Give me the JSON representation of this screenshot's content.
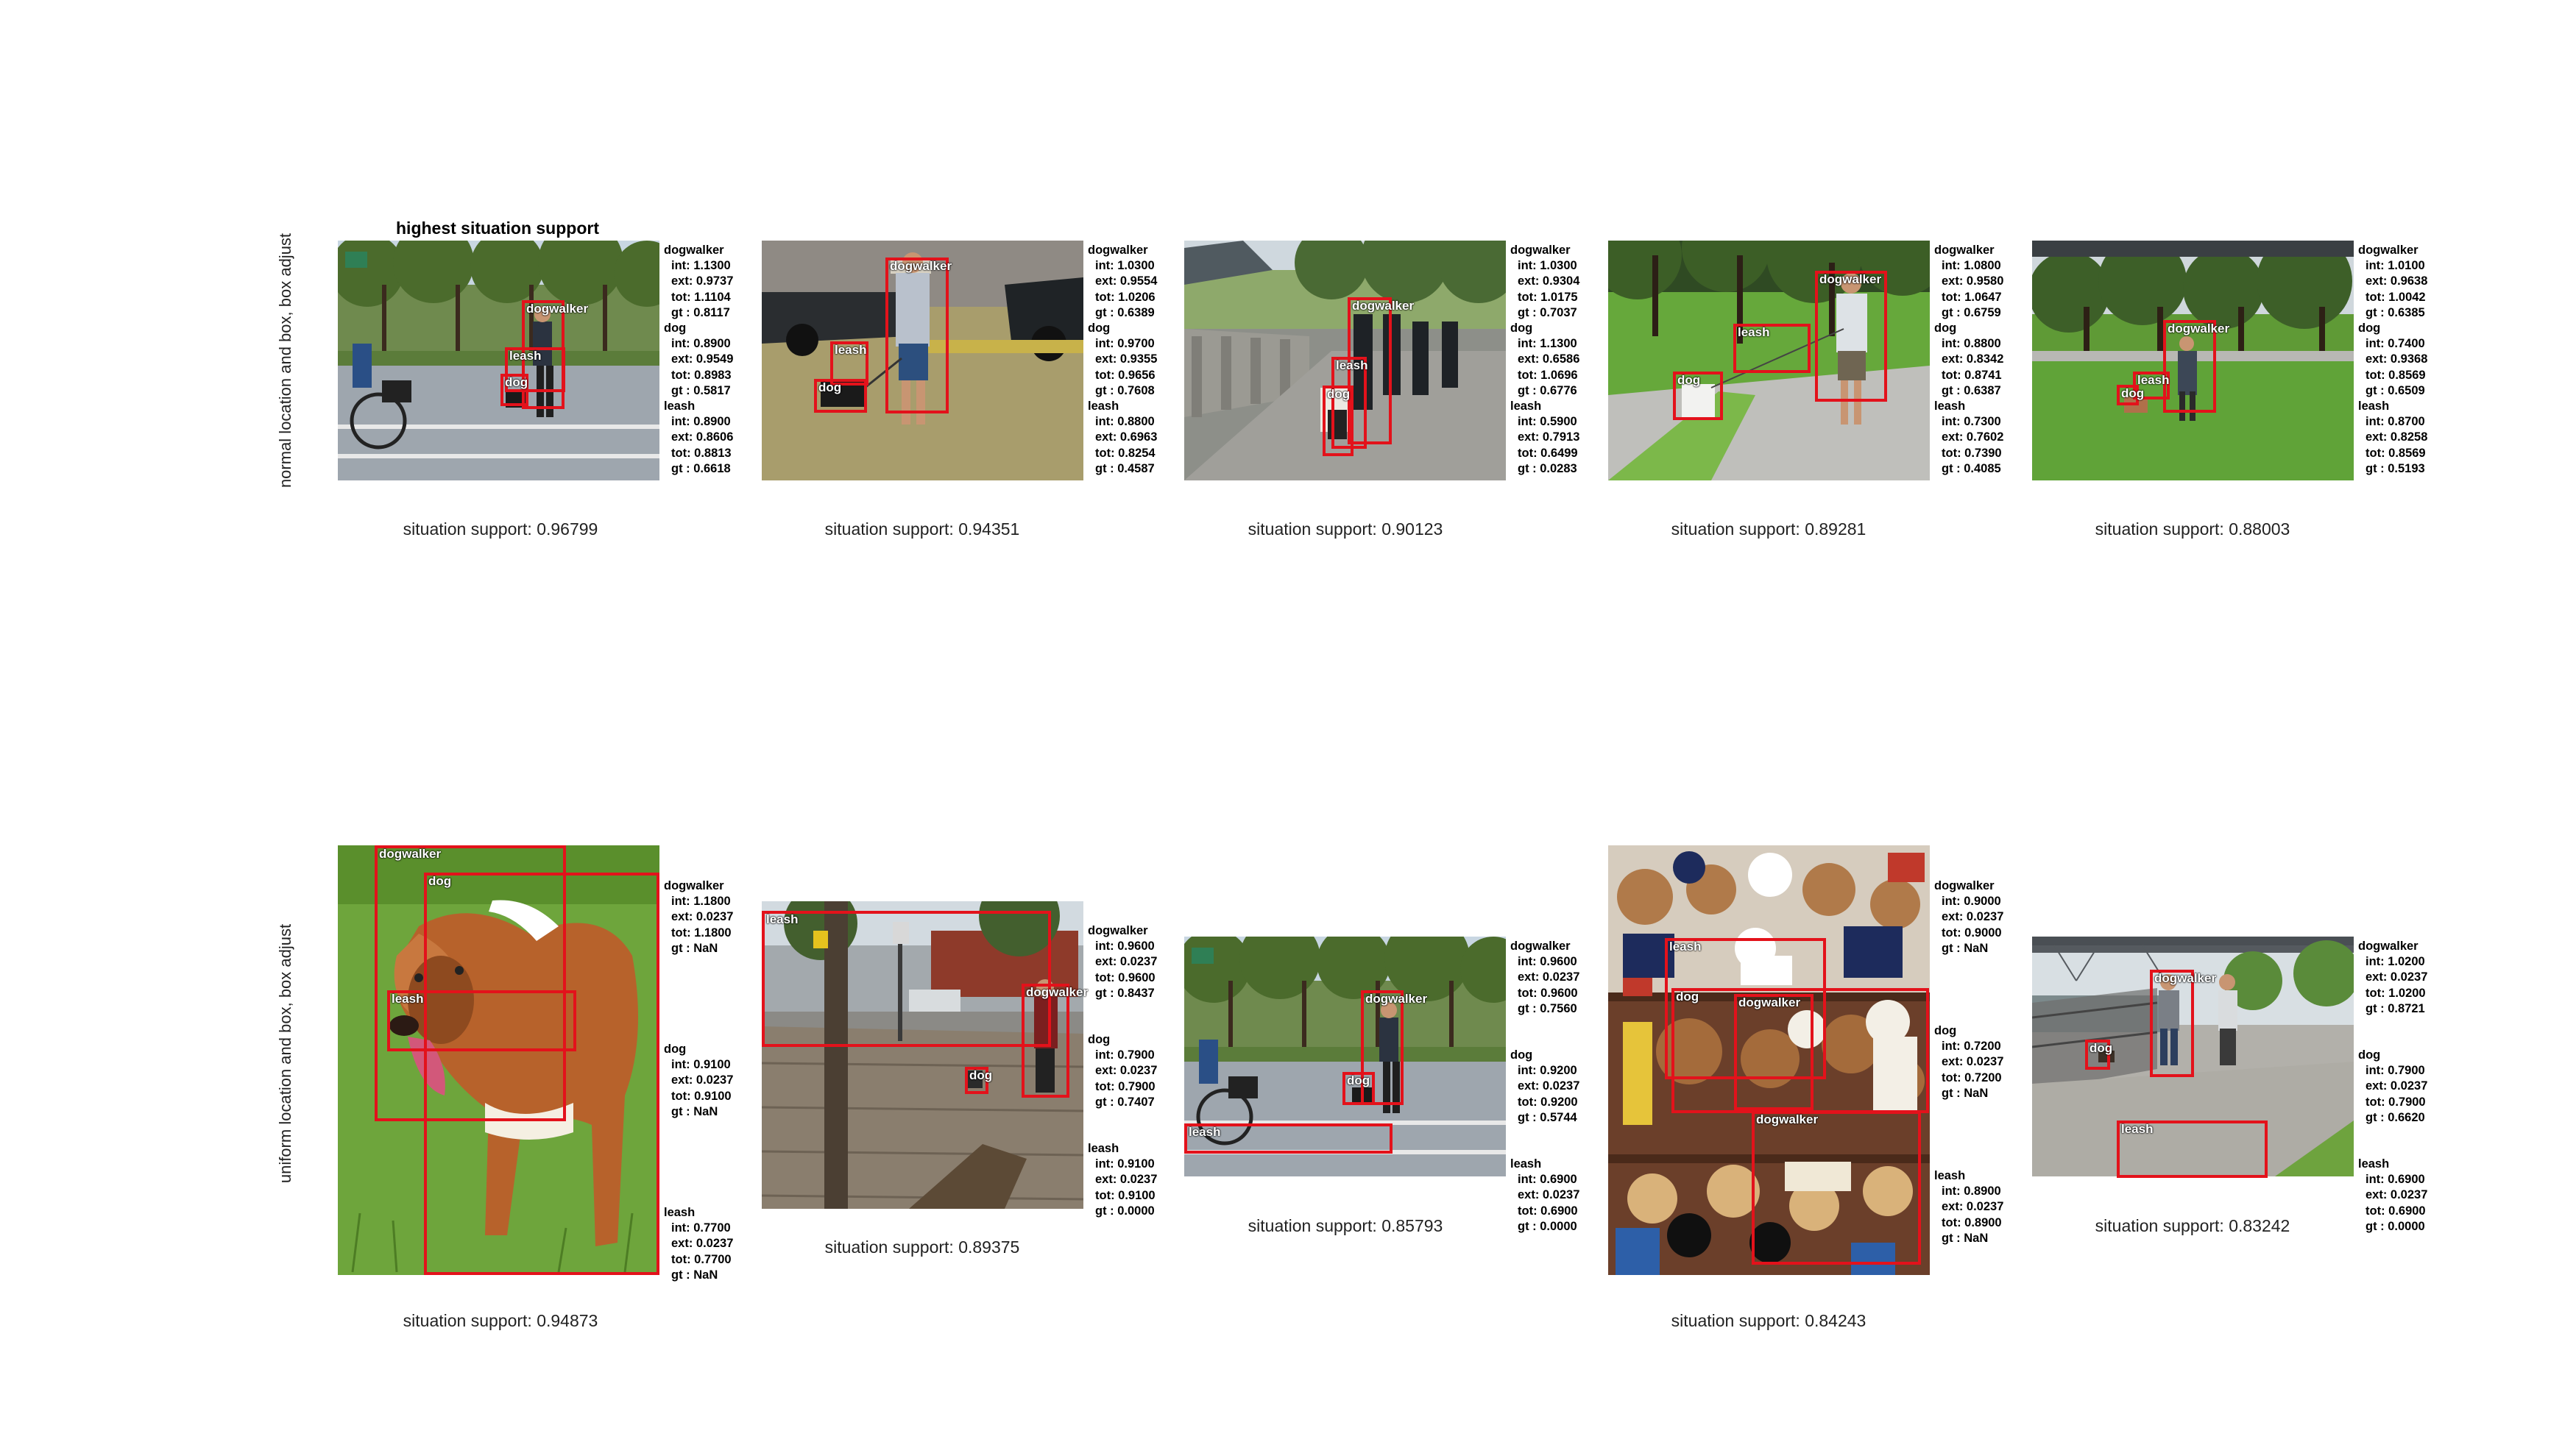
{
  "title": "highest situation support",
  "rows": [
    {
      "label": "normal location and box, box adjust",
      "cells": [
        {
          "scene": "street",
          "support": "situation support: 0.96799",
          "boxes": [
            {
              "label": "dogwalker"
            },
            {
              "label": "leash"
            },
            {
              "label": "dog"
            }
          ],
          "scores": [
            {
              "role": "dogwalker",
              "int": "int: 1.1300",
              "ext": "ext: 0.9737",
              "tot": "tot: 1.1104",
              "gt": "gt : 0.8117"
            },
            {
              "role": "dog",
              "int": "int: 0.8900",
              "ext": "ext: 0.9549",
              "tot": "tot: 0.8983",
              "gt": "gt : 0.5817"
            },
            {
              "role": "leash",
              "int": "int: 0.8900",
              "ext": "ext: 0.8606",
              "tot": "tot: 0.8813",
              "gt": "gt : 0.6618"
            }
          ]
        },
        {
          "scene": "lawn-cars",
          "support": "situation support: 0.94351",
          "boxes": [
            {
              "label": "dogwalker"
            },
            {
              "label": "leash"
            },
            {
              "label": "dog"
            }
          ],
          "scores": [
            {
              "role": "dogwalker",
              "int": "int: 1.0300",
              "ext": "ext: 0.9554",
              "tot": "tot: 1.0206",
              "gt": "gt : 0.6389"
            },
            {
              "role": "dog",
              "int": "int: 0.9700",
              "ext": "ext: 0.9355",
              "tot": "tot: 0.9656",
              "gt": "gt : 0.7608"
            },
            {
              "role": "leash",
              "int": "int: 0.8800",
              "ext": "ext: 0.6963",
              "tot": "tot: 0.8254",
              "gt": "gt : 0.4587"
            }
          ]
        },
        {
          "scene": "promenade",
          "support": "situation support: 0.90123",
          "boxes": [
            {
              "label": "dogwalker"
            },
            {
              "label": "leash"
            },
            {
              "label": "dog"
            }
          ],
          "scores": [
            {
              "role": "dogwalker",
              "int": "int: 1.0300",
              "ext": "ext: 0.9304",
              "tot": "tot: 1.0175",
              "gt": "gt : 0.7037"
            },
            {
              "role": "dog",
              "int": "int: 1.1300",
              "ext": "ext: 0.6586",
              "tot": "tot: 1.0696",
              "gt": "gt : 0.6776"
            },
            {
              "role": "leash",
              "int": "int: 0.5900",
              "ext": "ext: 0.7913",
              "tot": "tot: 0.6499",
              "gt": "gt : 0.0283"
            }
          ]
        },
        {
          "scene": "park-path",
          "support": "situation support: 0.89281",
          "boxes": [
            {
              "label": "dogwalker"
            },
            {
              "label": "leash"
            },
            {
              "label": "dog"
            }
          ],
          "scores": [
            {
              "role": "dogwalker",
              "int": "int: 1.0800",
              "ext": "ext: 0.9580",
              "tot": "tot: 1.0647",
              "gt": "gt : 0.6759"
            },
            {
              "role": "dog",
              "int": "int: 0.8800",
              "ext": "ext: 0.8342",
              "tot": "tot: 0.8741",
              "gt": "gt : 0.6387"
            },
            {
              "role": "leash",
              "int": "int: 0.7300",
              "ext": "ext: 0.7602",
              "tot": "tot: 0.7390",
              "gt": "gt : 0.4085"
            }
          ]
        },
        {
          "scene": "park-trees",
          "support": "situation support: 0.88003",
          "boxes": [
            {
              "label": "dogwalker"
            },
            {
              "label": "leash"
            },
            {
              "label": "dog"
            }
          ],
          "scores": [
            {
              "role": "dogwalker",
              "int": "int: 1.0100",
              "ext": "ext: 0.9638",
              "tot": "tot: 1.0042",
              "gt": "gt : 0.6385"
            },
            {
              "role": "dog",
              "int": "int: 0.7400",
              "ext": "ext: 0.9368",
              "tot": "tot: 0.8569",
              "gt": "gt : 0.6509"
            },
            {
              "role": "leash",
              "int": "int: 0.8700",
              "ext": "ext: 0.8258",
              "tot": "tot: 0.8569",
              "gt": "gt : 0.5193"
            }
          ]
        }
      ]
    },
    {
      "label": "uniform location and box, box adjust",
      "cells": [
        {
          "scene": "dog-closeup",
          "support": "situation support: 0.94873",
          "boxes": [
            {
              "label": "dogwalker"
            },
            {
              "label": "dog"
            },
            {
              "label": "leash"
            }
          ],
          "scores": [
            {
              "role": "dogwalker",
              "int": "int: 1.1800",
              "ext": "ext: 0.0237",
              "tot": "tot: 1.1800",
              "gt": "gt : NaN"
            },
            {
              "role": "dog",
              "int": "int: 0.9100",
              "ext": "ext: 0.0237",
              "tot": "tot: 0.9100",
              "gt": "gt : NaN"
            },
            {
              "role": "leash",
              "int": "int: 0.7700",
              "ext": "ext: 0.0237",
              "tot": "tot: 0.7700",
              "gt": "gt : NaN"
            }
          ]
        },
        {
          "scene": "boardwalk",
          "support": "situation support: 0.89375",
          "boxes": [
            {
              "label": "leash"
            },
            {
              "label": "dogwalker"
            },
            {
              "label": "dog"
            }
          ],
          "scores": [
            {
              "role": "dogwalker",
              "int": "int: 0.9600",
              "ext": "ext: 0.0237",
              "tot": "tot: 0.9600",
              "gt": "gt : 0.8437"
            },
            {
              "role": "dog",
              "int": "int: 0.7900",
              "ext": "ext: 0.0237",
              "tot": "tot: 0.7900",
              "gt": "gt : 0.7407"
            },
            {
              "role": "leash",
              "int": "int: 0.9100",
              "ext": "ext: 0.0237",
              "tot": "tot: 0.9100",
              "gt": "gt : 0.0000"
            }
          ]
        },
        {
          "scene": "street",
          "support": "situation support: 0.85793",
          "boxes": [
            {
              "label": "dogwalker"
            },
            {
              "label": "dog"
            },
            {
              "label": "leash"
            }
          ],
          "scores": [
            {
              "role": "dogwalker",
              "int": "int: 0.9600",
              "ext": "ext: 0.0237",
              "tot": "tot: 0.9600",
              "gt": "gt : 0.7560"
            },
            {
              "role": "dog",
              "int": "int: 0.9200",
              "ext": "ext: 0.0237",
              "tot": "tot: 0.9200",
              "gt": "gt : 0.5744"
            },
            {
              "role": "leash",
              "int": "int: 0.6900",
              "ext": "ext: 0.0237",
              "tot": "tot: 0.6900",
              "gt": "gt : 0.0000"
            }
          ]
        },
        {
          "scene": "toy-shelf",
          "support": "situation support: 0.84243",
          "boxes": [
            {
              "label": "leash"
            },
            {
              "label": "dogwalker"
            },
            {
              "label": "dog"
            },
            {
              "label": "dogwalker"
            }
          ],
          "scores": [
            {
              "role": "dogwalker",
              "int": "int: 0.9000",
              "ext": "ext: 0.0237",
              "tot": "tot: 0.9000",
              "gt": "gt : NaN"
            },
            {
              "role": "dog",
              "int": "int: 0.7200",
              "ext": "ext: 0.0237",
              "tot": "tot: 0.7200",
              "gt": "gt : NaN"
            },
            {
              "role": "leash",
              "int": "int: 0.8900",
              "ext": "ext: 0.0237",
              "tot": "tot: 0.8900",
              "gt": "gt : NaN"
            }
          ]
        },
        {
          "scene": "waterfront",
          "support": "situation support: 0.83242",
          "boxes": [
            {
              "label": "dogwalker"
            },
            {
              "label": "dog"
            },
            {
              "label": "leash"
            }
          ],
          "scores": [
            {
              "role": "dogwalker",
              "int": "int: 1.0200",
              "ext": "ext: 0.0237",
              "tot": "tot: 1.0200",
              "gt": "gt : 0.8721"
            },
            {
              "role": "dog",
              "int": "int: 0.7900",
              "ext": "ext: 0.0237",
              "tot": "tot: 0.7900",
              "gt": "gt : 0.6620"
            },
            {
              "role": "leash",
              "int": "int: 0.6900",
              "ext": "ext: 0.0237",
              "tot": "tot: 0.6900",
              "gt": "gt : 0.0000"
            }
          ]
        }
      ]
    }
  ]
}
